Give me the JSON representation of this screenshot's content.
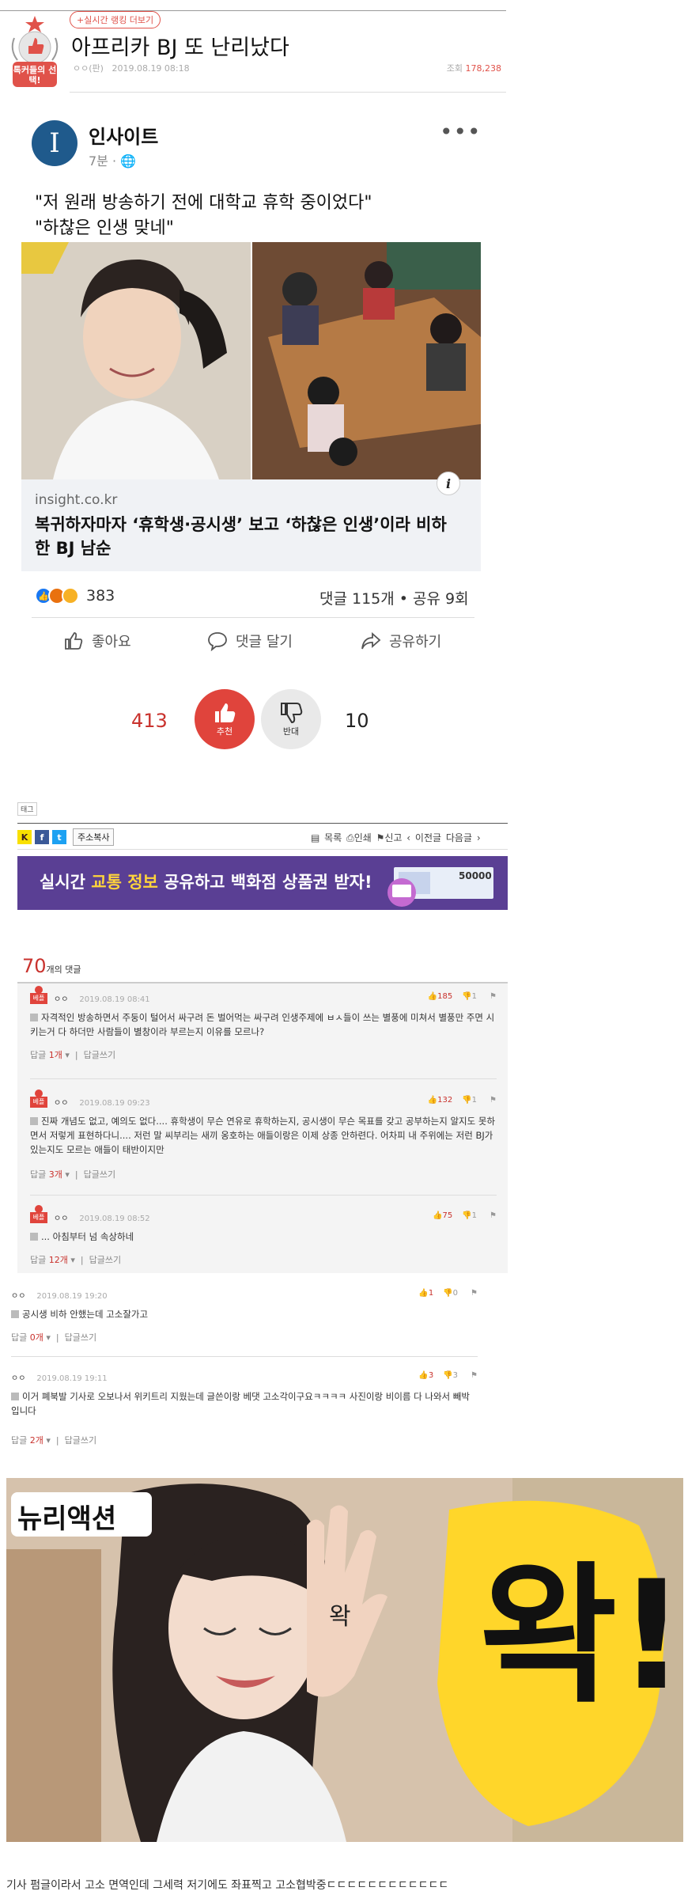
{
  "post": {
    "tag_link": "+실시간 랭킹 더보기",
    "badge_text": "톡커들의 선택!",
    "title": "아프리카 BJ 또 난리났다",
    "author": "ㅇㅇ(판)",
    "date": "2019.08.19 08:18",
    "views_label": "조회",
    "views": "178,238"
  },
  "embed": {
    "page_name": "인사이트",
    "logo_letter": "I",
    "time": "7분 · ",
    "more": "•••",
    "text_line1": "\"저 원래 방송하기 전에 대학교 휴학 중이었다\"",
    "text_line2": "\"하찮은 인생 맞네\"",
    "link_host": "insight.co.kr",
    "link_title": "복귀하자마자 ‘휴학생·공시생’ 보고 ‘하찮은 인생’이라 비하한 BJ 남순",
    "info_icon": "i",
    "reaction_count": "383",
    "stats": "댓글 115개 • 공유 9회",
    "actions": {
      "like": "좋아요",
      "comment": "댓글 달기",
      "share": "공유하기"
    }
  },
  "vote": {
    "up_count": "413",
    "up_label": "추천",
    "down_count": "10",
    "down_label": "반대"
  },
  "toolbar": {
    "tag_label": "태그",
    "copy_label": "주소복사",
    "list": "목록",
    "print": "인쇄",
    "report": "신고",
    "prev": "이전글",
    "next": "다음글"
  },
  "banner": {
    "pre": "실시간 ",
    "highlight": "교통 정보",
    "post": " 공유하고 백화점 상품권 받자!",
    "voucher": "50000"
  },
  "comments_header": {
    "count": "70",
    "label": "개의 댓글"
  },
  "best_label": "베플",
  "comments": [
    {
      "user": "ㅇㅇ",
      "date": "2019.08.19 08:41",
      "up": "185",
      "down": "1",
      "body": "자격적인 방송하면서 주둥이 털어서 싸구려 돈 벌어먹는 싸구려 인생주제에 ㅂㅅ들이 쓰는 별풍에 미쳐서 별풍만 주면 시키는거 다 하더만 사람들이 별창이라 부르는지 이유를 모르나?",
      "reply_label": "답글",
      "reply_count": "1개",
      "write": "답글쓰기"
    },
    {
      "user": "ㅇㅇ",
      "date": "2019.08.19 09:23",
      "up": "132",
      "down": "1",
      "body": "진짜 개념도 없고, 예의도 없다.... 휴학생이 무슨 연유로 휴학하는지, 공시생이 무슨 목표를 갖고 공부하는지 알지도 못하면서 저렇게 표현하다니.... 저런 말 씨부리는 새끼 옹호하는 애들이랑은 이제 상종 안하련다. 어차피 내 주위에는 저런 BJ가 있는지도 모르는 애들이 태반이지만",
      "reply_label": "답글",
      "reply_count": "3개",
      "write": "답글쓰기"
    },
    {
      "user": "ㅇㅇ",
      "date": "2019.08.19 08:52",
      "up": "75",
      "down": "1",
      "body": "... 아침부터 넘 속상하네",
      "reply_label": "답글",
      "reply_count": "12개",
      "write": "답글쓰기"
    }
  ],
  "normal_comments": [
    {
      "user": "ㅇㅇ",
      "date": "2019.08.19 19:20",
      "up": "1",
      "down": "0",
      "body": "공시생 비하 안했는데 고소잘가고",
      "reply_label": "답글",
      "reply_count": "0개",
      "write": "답글쓰기"
    },
    {
      "user": "ㅇㅇ",
      "date": "2019.08.19 19:11",
      "up": "3",
      "down": "3",
      "body": "이거 폐북발 기사로 오보나서 위키트리 지웠는데 글쓴이랑 베댓 고소각이구요ㅋㅋㅋㅋ 사진이랑 비이름 다 나와서 빼박입니다",
      "reply_label": "답글",
      "reply_count": "2개",
      "write": "답글쓰기"
    }
  ],
  "image": {
    "badge": "뉴리액션",
    "big_word": "왁!",
    "hand_word": "왁"
  },
  "footer_text": "기사 펌글이라서 고소 면역인데 그세력 저기에도 좌표찍고 고소협박중ㄷㄷㄷㄷㄷㄷㄷㄷㄷㄷㄷㄷ",
  "colors": {
    "accent": "#c9322d",
    "fb_blue": "#1877f2",
    "banner": "#5a3f94"
  }
}
